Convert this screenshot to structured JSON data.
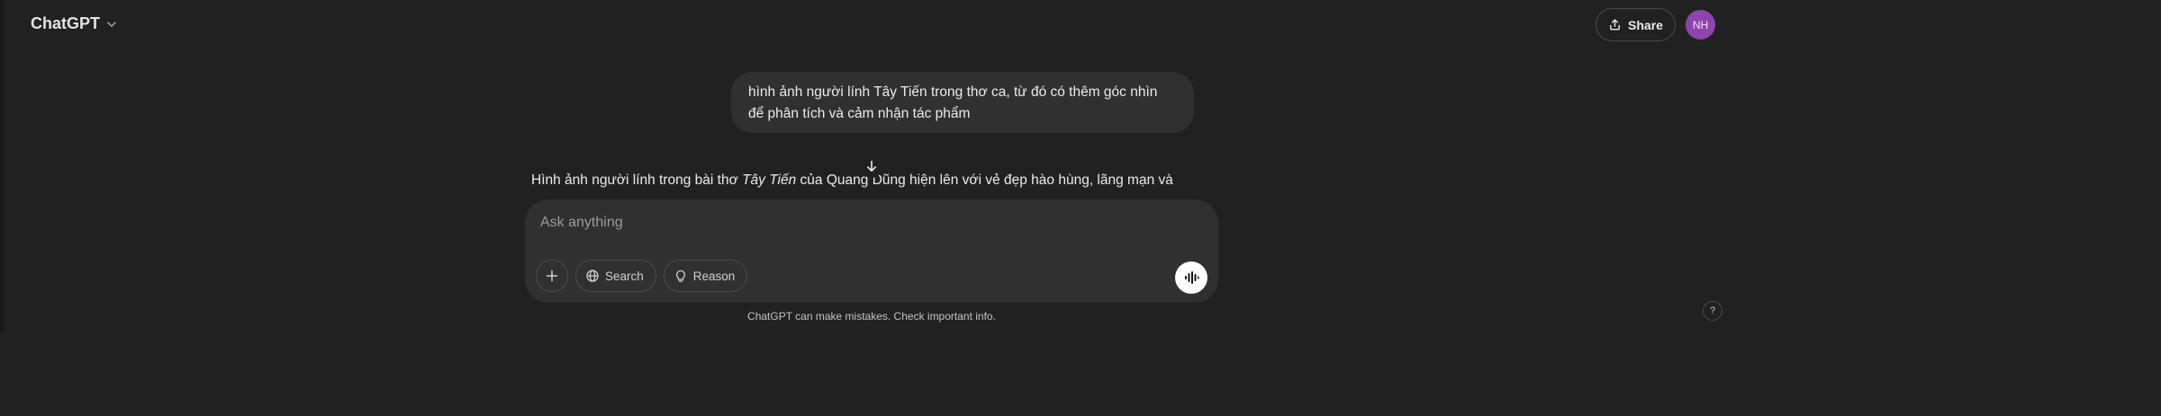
{
  "header": {
    "model_name": "ChatGPT",
    "share_label": "Share",
    "avatar_initials": "NH"
  },
  "conversation": {
    "user_message": {
      "line1": "hình ảnh người lính Tây Tiến trong thơ ca, từ đó có thêm góc nhìn",
      "line2": "để phân tích và cảm nhận tác phẩm"
    },
    "assistant_preview": {
      "before": "Hình ảnh người lính trong bài thơ ",
      "italic": "Tây Tiến",
      "after": " của Quang Dũng hiện lên với vẻ đẹp hào hùng, lãng mạn và"
    }
  },
  "composer": {
    "placeholder": "Ask anything",
    "search_label": "Search",
    "reason_label": "Reason"
  },
  "footer": {
    "disclaimer": "ChatGPT can make mistakes. Check important info.",
    "help_label": "?"
  },
  "colors": {
    "background": "#212121",
    "surface": "#303030",
    "avatar": "#8e44ad",
    "text": "#ececec"
  }
}
